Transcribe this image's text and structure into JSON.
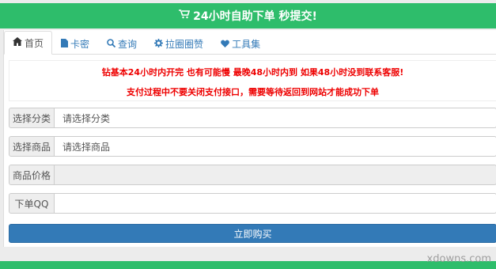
{
  "header": {
    "title": "24小时自助下单 秒提交!",
    "icon": "cart-icon"
  },
  "tabs": [
    {
      "label": "首页",
      "icon": "home-icon"
    },
    {
      "label": "卡密",
      "icon": "file-icon"
    },
    {
      "label": "查询",
      "icon": "search-icon"
    },
    {
      "label": "拉圈圈赞",
      "icon": "gear-icon"
    },
    {
      "label": "工具集",
      "icon": "heart-icon"
    }
  ],
  "notice": {
    "line1": "钻基本24小时内开完 也有可能慢 最晚48小时内到 如果48小时没到联系客服!",
    "line2": "支付过程中不要关闭支付接口，需要等待返回到网站才能成功下单"
  },
  "form": {
    "category_label": "选择分类",
    "category_value": "请选择分类",
    "product_label": "选择商品",
    "product_value": "请选择商品",
    "price_label": "商品价格",
    "price_value": "",
    "qq_label": "下单QQ",
    "qq_value": ""
  },
  "buy_button": "立即购买",
  "watermark": "xdowns.com",
  "colors": {
    "header_green": "#2ebd6b",
    "notice_red": "#e00000",
    "button_blue": "#337ab7"
  }
}
